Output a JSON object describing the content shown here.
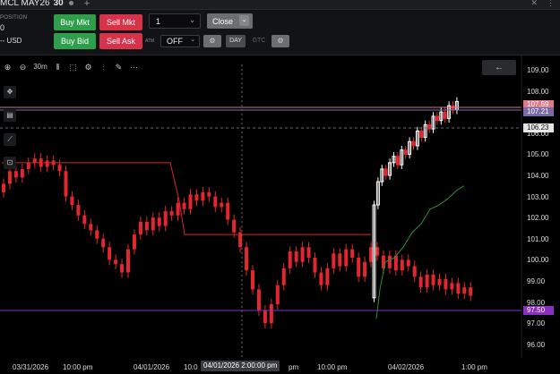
{
  "window": {
    "tab_title_symbol": "MCL MAY26",
    "tab_title_interval": "30",
    "tab_title_unit": "m"
  },
  "position": {
    "label": "POSITION",
    "value": "0",
    "unit": "-- USD"
  },
  "order": {
    "buy_mkt": "Buy Mkt",
    "sell_mkt": "Sell Mkt",
    "buy_bid": "Buy Bid",
    "sell_ask": "Sell Ask",
    "quantity": "1",
    "close": "Close",
    "atm_label": "ATM",
    "tif": "OFF",
    "day": "DAY",
    "gtc": "GTC"
  },
  "toolbar": {
    "interval_label": "30m"
  },
  "colors": {
    "bull": "#ffffff",
    "bear": "#e3262f",
    "green_button": "#2e9e4a",
    "red_button": "#d8314a",
    "vwap_green": "#2f8f35",
    "vwap_red": "#d8262a",
    "upper_tag": "#e07a8a",
    "last_tag": "#7a6aa8",
    "low_tag": "#8a2fc0"
  },
  "price_axis": {
    "ticks": [
      "109.00",
      "108.00",
      "107.00",
      "106.00",
      "105.00",
      "104.00",
      "103.00",
      "102.00",
      "101.00",
      "100.00",
      "99.00",
      "98.00",
      "97.00",
      "96.00"
    ],
    "tag_upper": "107.59",
    "tag_last": "107.21",
    "tag_mid": "106.23",
    "tag_low": "97.50"
  },
  "time_axis": {
    "labels": [
      "03/31/2026",
      "10:00 pm",
      "04/01/2026",
      "10:0",
      "10:00 pm",
      "04/02/2026",
      "1:00 pm"
    ],
    "crosshair": "04/01/2026 2:00:00 pm",
    "label_after_crosshair": "pm"
  }
}
